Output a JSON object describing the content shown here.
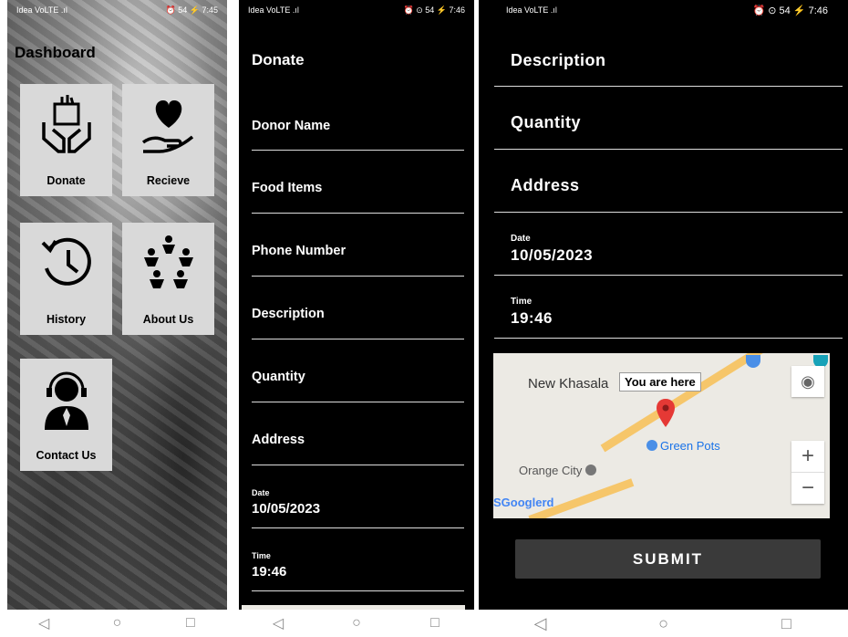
{
  "screen1": {
    "status": {
      "left": "Idea VoLTE .ıl",
      "right": "⏰ 54 ⚡ 7:45"
    },
    "title": "Dashboard",
    "tiles": [
      {
        "label": "Donate",
        "icon": "donate-hands-icon"
      },
      {
        "label": "Recieve",
        "icon": "heart-hand-icon"
      },
      {
        "label": "History",
        "icon": "history-clock-icon"
      },
      {
        "label": "About Us",
        "icon": "people-circle-icon"
      },
      {
        "label": "Contact Us",
        "icon": "support-agent-icon"
      }
    ]
  },
  "screen2": {
    "status": {
      "left": "Idea VoLTE .ıl",
      "right": "⏰ ⊙ 54 ⚡ 7:46"
    },
    "title": "Donate",
    "fields": [
      "Donor Name",
      "Food Items",
      "Phone Number",
      "Description",
      "Quantity",
      "Address"
    ],
    "date_label": "Date",
    "date_value": "10/05/2023",
    "time_label": "Time",
    "time_value": "19:46"
  },
  "screen3": {
    "status": {
      "left": "Idea VoLTE .ıl",
      "right": "⏰ ⊙ 54 ⚡ 7:46"
    },
    "fields": [
      "Description",
      "Quantity",
      "Address"
    ],
    "date_label": "Date",
    "date_value": "10/05/2023",
    "time_label": "Time",
    "time_value": "19:46",
    "map": {
      "place1": "New Khasala",
      "marker_label": "You are here",
      "place2": "Green Pots",
      "place3": "Orange City",
      "place4": "SGooglerd",
      "zoom_in": "+",
      "zoom_out": "−"
    },
    "submit_label": "SUBMIT"
  },
  "nav": {
    "back": "◁",
    "home": "○",
    "recent": "□"
  },
  "colors": {
    "screen_bg": "#000000",
    "tile_bg": "#d9d9d9",
    "marker": "#e53935",
    "road": "#f6c66a",
    "submit_bg": "#3a3a3a"
  }
}
